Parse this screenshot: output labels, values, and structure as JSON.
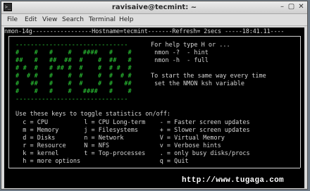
{
  "window": {
    "title": "ravisaive@tecmint: ~",
    "icon_glyph": ">_",
    "minimize_glyph": "–",
    "maximize_glyph": "▢",
    "close_glyph": "✕"
  },
  "menu": [
    "File",
    "Edit",
    "View",
    "Search",
    "Terminal",
    "Help"
  ],
  "terminal": {
    "top_line": "nmon-14g-----------------Hostname=tecmint-------Refresh= 2secs -----18:41.11----",
    "art_lines": [
      "------------------------------",
      "#    #   #    #   ####   #    #",
      "##   #   ##  ##  #    #  ##   #",
      "# #  #   # ## #  #    #  # #  #",
      "#  # #   #    #  #    #  #  # #",
      "#   ##   #    #  #    #  #   ##",
      "#    #   #    #   ####   #    #",
      "------------------------------"
    ],
    "help_lines": [
      "For help type H or ...",
      " nmon -?  - hint",
      " nmon -h  - full",
      "",
      "To start the same way every time",
      " set the NMON ksh variable"
    ],
    "toggle_heading": "Use these keys to toggle statistics on/off:",
    "toggle_rows": [
      "  c = CPU          l = CPU Long-term    - = Faster screen updates",
      "  m = Memory       j = Filesystems      + = Slower screen updates",
      "  d = Disks        n = Network          V = Virtual Memory",
      "  r = Resource     N = NFS              v = Verbose hints",
      "  k = kernel       t = Top-processes    . = only busy disks/procs",
      "  h = more options                      q = Quit"
    ]
  },
  "watermark": "http://www.tugaga.com"
}
